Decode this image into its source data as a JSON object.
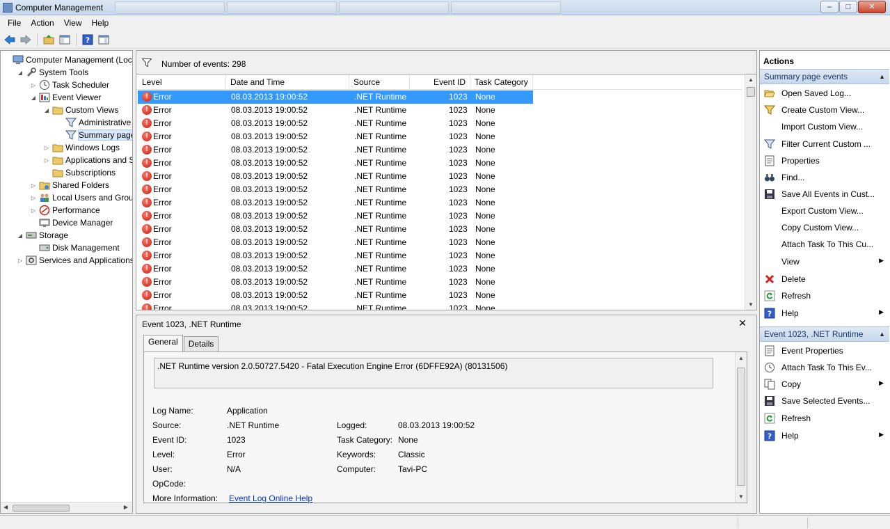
{
  "window": {
    "title": "Computer Management",
    "controls": {
      "minimize": "–",
      "maximize": "□",
      "close": "✕"
    }
  },
  "menu": [
    "File",
    "Action",
    "View",
    "Help"
  ],
  "tree": [
    {
      "label": "Computer Management (Local",
      "level": 0,
      "expander": "",
      "icon": "computer-icon"
    },
    {
      "label": "System Tools",
      "level": 1,
      "expander": "◢",
      "icon": "tools-icon"
    },
    {
      "label": "Task Scheduler",
      "level": 2,
      "expander": "▷",
      "icon": "clock-icon"
    },
    {
      "label": "Event Viewer",
      "level": 2,
      "expander": "◢",
      "icon": "event-viewer-icon"
    },
    {
      "label": "Custom Views",
      "level": 3,
      "expander": "◢",
      "icon": "folder-icon"
    },
    {
      "label": "Administrative E",
      "level": 4,
      "expander": "",
      "icon": "filter-icon"
    },
    {
      "label": "Summary page e",
      "level": 4,
      "expander": "",
      "icon": "filter-icon",
      "selected": true
    },
    {
      "label": "Windows Logs",
      "level": 3,
      "expander": "▷",
      "icon": "folder-icon"
    },
    {
      "label": "Applications and Se",
      "level": 3,
      "expander": "▷",
      "icon": "folder-icon"
    },
    {
      "label": "Subscriptions",
      "level": 3,
      "expander": "",
      "icon": "folder-icon"
    },
    {
      "label": "Shared Folders",
      "level": 2,
      "expander": "▷",
      "icon": "shared-folder-icon"
    },
    {
      "label": "Local Users and Groups",
      "level": 2,
      "expander": "▷",
      "icon": "users-icon"
    },
    {
      "label": "Performance",
      "level": 2,
      "expander": "▷",
      "icon": "performance-icon"
    },
    {
      "label": "Device Manager",
      "level": 2,
      "expander": "",
      "icon": "device-manager-icon"
    },
    {
      "label": "Storage",
      "level": 1,
      "expander": "◢",
      "icon": "storage-icon"
    },
    {
      "label": "Disk Management",
      "level": 2,
      "expander": "",
      "icon": "disk-icon"
    },
    {
      "label": "Services and Applications",
      "level": 1,
      "expander": "▷",
      "icon": "services-icon"
    }
  ],
  "events": {
    "count_label": "Number of events: 298",
    "columns": [
      "Level",
      "Date and Time",
      "Source",
      "Event ID",
      "Task Category"
    ],
    "row": {
      "level": "Error",
      "date": "08.03.2013 19:00:52",
      "source": ".NET Runtime",
      "event_id": "1023",
      "category": "None"
    },
    "visible_rows": 17,
    "selected_row": 0
  },
  "detail": {
    "title": "Event 1023, .NET Runtime",
    "close": "✕",
    "tabs": [
      "General",
      "Details"
    ],
    "description": ".NET Runtime version 2.0.50727.5420 - Fatal Execution Engine Error (6DFFE92A) (80131506)",
    "fields_left": [
      {
        "label": "Log Name:",
        "value": "Application"
      },
      {
        "label": "Source:",
        "value": ".NET Runtime"
      },
      {
        "label": "Event ID:",
        "value": "1023"
      },
      {
        "label": "Level:",
        "value": "Error"
      },
      {
        "label": "User:",
        "value": "N/A"
      },
      {
        "label": "OpCode:",
        "value": ""
      },
      {
        "label": "More Information:",
        "value": "Event Log Online Help"
      }
    ],
    "fields_right": [
      {
        "label": "Logged:",
        "value": "08.03.2013 19:00:52"
      },
      {
        "label": "Task Category:",
        "value": "None"
      },
      {
        "label": "Keywords:",
        "value": "Classic"
      },
      {
        "label": "Computer:",
        "value": "Tavi-PC"
      }
    ]
  },
  "actions": {
    "header": "Actions",
    "section1": {
      "title": "Summary page events",
      "items": [
        {
          "label": "Open Saved Log...",
          "icon": "open-folder-icon"
        },
        {
          "label": "Create Custom View...",
          "icon": "create-filter-icon"
        },
        {
          "label": "Import Custom View...",
          "icon": ""
        },
        {
          "label": "Filter Current Custom ...",
          "icon": "filter-icon"
        },
        {
          "label": "Properties",
          "icon": "properties-icon"
        },
        {
          "label": "Find...",
          "icon": "binoculars-icon"
        },
        {
          "label": "Save All Events in Cust...",
          "icon": "save-icon"
        },
        {
          "label": "Export Custom View...",
          "icon": ""
        },
        {
          "label": "Copy Custom View...",
          "icon": ""
        },
        {
          "label": "Attach Task To This Cu...",
          "icon": ""
        },
        {
          "label": "View",
          "icon": "",
          "submenu": true
        },
        {
          "label": "Delete",
          "icon": "delete-icon"
        },
        {
          "label": "Refresh",
          "icon": "refresh-icon"
        },
        {
          "label": "Help",
          "icon": "help-icon",
          "submenu": true
        }
      ]
    },
    "section2": {
      "title": "Event 1023, .NET Runtime",
      "items": [
        {
          "label": "Event Properties",
          "icon": "properties-icon"
        },
        {
          "label": "Attach Task To This Ev...",
          "icon": "clock-icon"
        },
        {
          "label": "Copy",
          "icon": "copy-icon",
          "submenu": true
        },
        {
          "label": "Save Selected Events...",
          "icon": "save-icon"
        },
        {
          "label": "Refresh",
          "icon": "refresh-icon"
        },
        {
          "label": "Help",
          "icon": "help-icon",
          "submenu": true
        }
      ]
    }
  },
  "colors": {
    "selection": "#3399ff",
    "error": "#c21d10",
    "link": "#0033cc",
    "section_header": "#c7d8ee"
  }
}
